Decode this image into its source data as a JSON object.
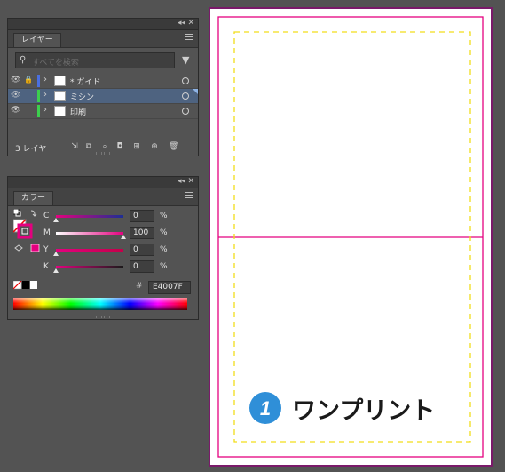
{
  "layers_panel": {
    "tab_label": "レイヤー",
    "collapse_glyph": "◂◂",
    "close_glyph": "✕",
    "search_placeholder": "すべてを検索",
    "layers": [
      {
        "name": "* ガイド",
        "color": "#4a6fe0",
        "selected": false,
        "locked": true
      },
      {
        "name": "ミシン",
        "color": "#3ccf4e",
        "selected": true,
        "locked": false
      },
      {
        "name": "印刷",
        "color": "#3ccf4e",
        "selected": false,
        "locked": false
      }
    ],
    "count_label": "3 レイヤー"
  },
  "color_panel": {
    "tab_label": "カラー",
    "collapse_glyph": "◂◂",
    "close_glyph": "✕",
    "sliders": [
      {
        "label": "C",
        "value": "0",
        "unit": "%",
        "level": 0,
        "color": "#1d2f95"
      },
      {
        "label": "M",
        "value": "100",
        "unit": "%",
        "level": 1,
        "color": "#e4007f"
      },
      {
        "label": "Y",
        "value": "0",
        "unit": "%",
        "level": 0,
        "color": "#c0006a"
      },
      {
        "label": "K",
        "value": "0",
        "unit": "%",
        "level": 0,
        "color": "#1a1a1a"
      }
    ],
    "hex_label": "#",
    "hex_value": "E4007F",
    "fill_color": "#ffffff",
    "stroke_color": "#e4007f"
  },
  "artboard": {
    "trim_color": "#e4007f",
    "guide_color": "#f2dd1a",
    "logo_text": "ワンプリント",
    "logo_badge": "1",
    "logo_badge_color": "#2f8fd8"
  }
}
